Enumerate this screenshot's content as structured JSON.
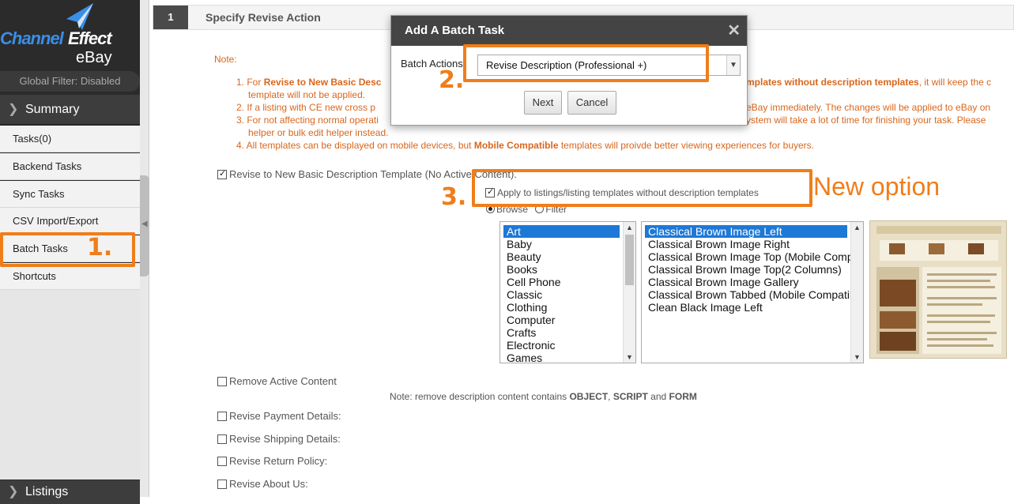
{
  "sidebar": {
    "logo": {
      "word1": "Channel",
      "word2": "Effect",
      "word3": "eBay"
    },
    "global_filter": "Global Filter: Disabled",
    "summary_label": "Summary",
    "items": [
      {
        "label": "Tasks(0)"
      },
      {
        "label": "Backend Tasks"
      },
      {
        "label": "Sync Tasks"
      },
      {
        "label": "CSV Import/Export"
      },
      {
        "label": "Batch Tasks"
      },
      {
        "label": "Shortcuts"
      }
    ],
    "listings_label": "Listings"
  },
  "step": {
    "number": "1",
    "title": "Specify Revise Action"
  },
  "notes": {
    "label": "Note:",
    "n1_prefix": "1. For ",
    "n1_bold": "Revise to New Basic Desc",
    "n1_right_bold": "mplates without description templates",
    "n1_right_rest": ", it will keep the c",
    "n1_cont": "template will not be applied.",
    "n2_left": "2. If a listing with CE new cross p",
    "n2_right": "eBay immediately. The changes will be applied to eBay on",
    "n3_left": "3. For not affecting normal operati",
    "n3_right": "ystem will take a lot of time for finishing your task. Please",
    "n3_cont": "helper or bulk edit helper instead.",
    "n4_pre": "4. All templates can be displayed on mobile devices, but ",
    "n4_bold": "Mobile Compatible",
    "n4_post": " templates will proivde better viewing experiences for buyers."
  },
  "options": {
    "revise_basic": "Revise to New Basic Description Template (No Active Content).",
    "apply_without": "Apply to listings/listing templates without description templates",
    "browse": "Browse",
    "filter": "Filter",
    "remove_active": "Remove Active Content",
    "remove_note_pre": "Note: remove description content contains ",
    "remove_note_b1": "OBJECT",
    "remove_note_sep1": ", ",
    "remove_note_b2": "SCRIPT",
    "remove_note_sep2": " and ",
    "remove_note_b3": "FORM",
    "payment": "Revise Payment Details:",
    "shipping": "Revise Shipping Details:",
    "return_policy": "Revise Return Policy:",
    "about_us": "Revise About Us:"
  },
  "categories": [
    "Art",
    "Baby",
    "Beauty",
    "Books",
    "Cell Phone",
    "Classic",
    "Clothing",
    "Computer",
    "Crafts",
    "Electronic",
    "Games"
  ],
  "templates": [
    "Classical Brown Image Left",
    "Classical Brown Image Right",
    "Classical Brown Image Top (Mobile Compatil",
    "Classical Brown Image Top(2 Columns)",
    "Classical Brown Image Gallery",
    "Classical Brown Tabbed (Mobile Compatible)",
    "Clean Black Image Left"
  ],
  "modal": {
    "title": "Add A Batch Task",
    "close": "✕",
    "label": "Batch Actions",
    "select_value": "Revise Description (Professional +)",
    "next": "Next",
    "cancel": "Cancel"
  },
  "annotations": {
    "step1": "1.",
    "step2": "2.",
    "step3": "3.",
    "new_option": "New option",
    "accent": "#f07d1a"
  },
  "colors": {
    "note_orange": "#d9661c",
    "selection_blue": "#1e78d6",
    "sidebar_dark": "#2b2b2b"
  }
}
